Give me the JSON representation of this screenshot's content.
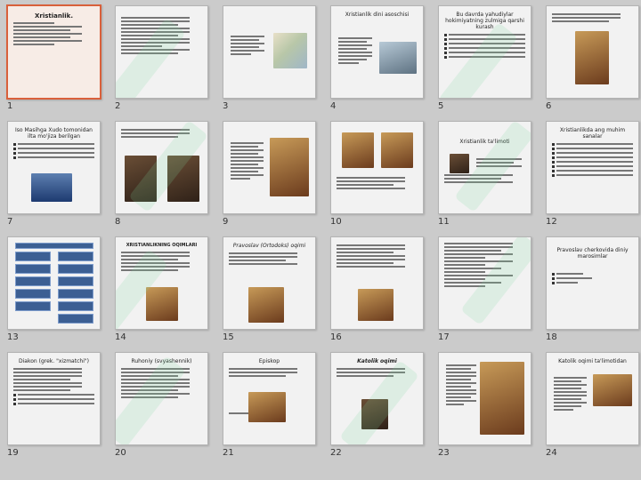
{
  "slides": [
    {
      "num": "1",
      "title": "Xristianlik.",
      "selected": true
    },
    {
      "num": "2",
      "title": ""
    },
    {
      "num": "3",
      "title": ""
    },
    {
      "num": "4",
      "title": "Xristianlik dini asoschisi"
    },
    {
      "num": "5",
      "title": "Bu davrda yahudiylar hokimiyatning zulmiga qarshi kurash"
    },
    {
      "num": "6",
      "title": ""
    },
    {
      "num": "7",
      "title": "Iso Masihga Xudo tomonidan ilta mo'jiza berilgan"
    },
    {
      "num": "8",
      "title": ""
    },
    {
      "num": "9",
      "title": ""
    },
    {
      "num": "10",
      "title": ""
    },
    {
      "num": "11",
      "title": "Xristianlik ta'limoti"
    },
    {
      "num": "12",
      "title": "Xristianlikda ang muhim sanalar"
    },
    {
      "num": "13",
      "title": ""
    },
    {
      "num": "14",
      "title": "XRISTIANLIKNING OQIMLARI"
    },
    {
      "num": "15",
      "title": "Pravoslav (Ortodoks) oqimi"
    },
    {
      "num": "16",
      "title": ""
    },
    {
      "num": "17",
      "title": ""
    },
    {
      "num": "18",
      "title": "Pravoslav cherkovida diniy marosimlar"
    },
    {
      "num": "19",
      "title": "Diakon (grek. \"xizmatchi\")"
    },
    {
      "num": "20",
      "title": "Ruhoniy (svyashennik)"
    },
    {
      "num": "21",
      "title": "Episkop"
    },
    {
      "num": "22",
      "title": "Katolik oqimi"
    },
    {
      "num": "23",
      "title": ""
    },
    {
      "num": "24",
      "title": "Katolik oqimi ta'limotidan"
    }
  ]
}
